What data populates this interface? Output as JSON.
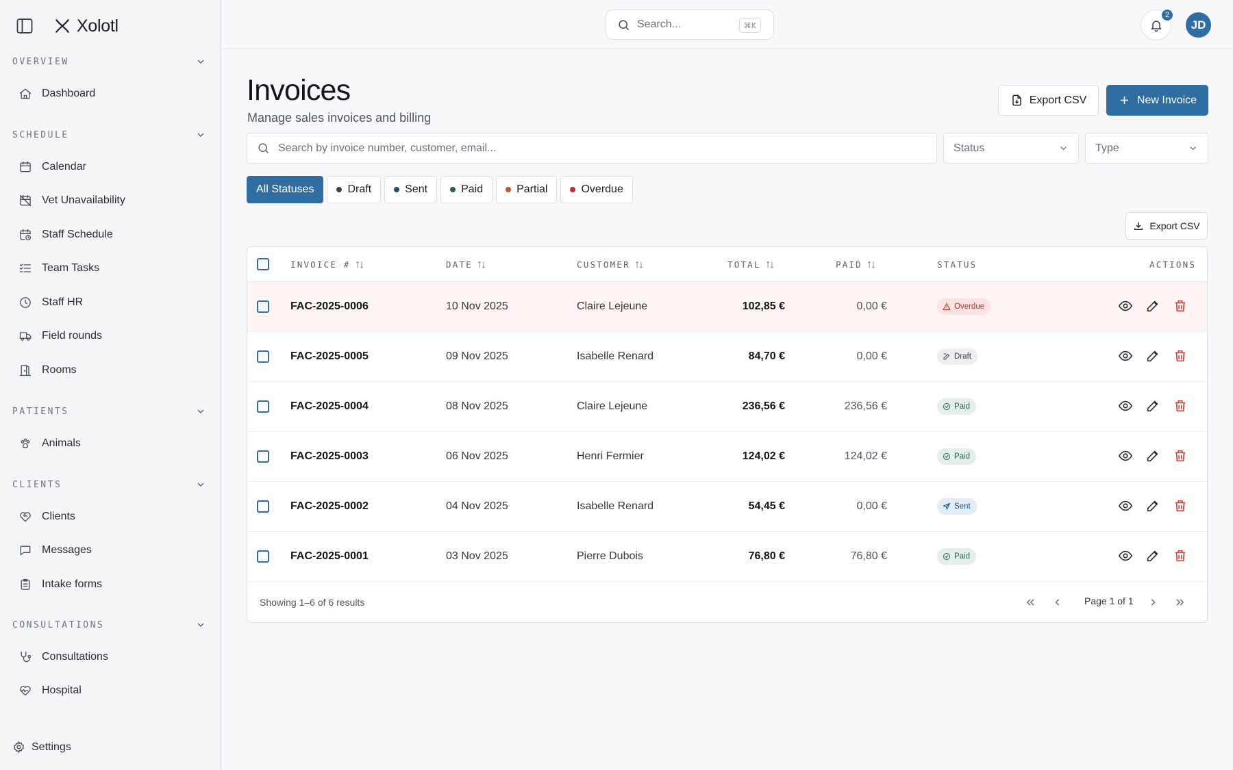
{
  "app": {
    "name": "Xolotl"
  },
  "sidebar": {
    "sections": [
      {
        "title": "OVERVIEW",
        "items": [
          {
            "label": "Dashboard",
            "icon": "home-icon"
          }
        ]
      },
      {
        "title": "SCHEDULE",
        "items": [
          {
            "label": "Calendar",
            "icon": "calendar-icon"
          },
          {
            "label": "Vet Unavailability",
            "icon": "calendar-off-icon"
          },
          {
            "label": "Staff Schedule",
            "icon": "calendar-clock-icon"
          },
          {
            "label": "Team Tasks",
            "icon": "list-checks-icon"
          },
          {
            "label": "Staff HR",
            "icon": "clock-icon"
          },
          {
            "label": "Field rounds",
            "icon": "truck-icon"
          },
          {
            "label": "Rooms",
            "icon": "door-icon"
          }
        ]
      },
      {
        "title": "PATIENTS",
        "items": [
          {
            "label": "Animals",
            "icon": "paw-icon"
          }
        ]
      },
      {
        "title": "CLIENTS",
        "items": [
          {
            "label": "Clients",
            "icon": "heart-handshake-icon"
          },
          {
            "label": "Messages",
            "icon": "message-icon"
          },
          {
            "label": "Intake forms",
            "icon": "clipboard-icon"
          }
        ]
      },
      {
        "title": "CONSULTATIONS",
        "items": [
          {
            "label": "Consultations",
            "icon": "stethoscope-icon"
          },
          {
            "label": "Hospital",
            "icon": "heart-pulse-icon"
          }
        ]
      }
    ],
    "settings_label": "Settings"
  },
  "topbar": {
    "search_placeholder": "Search...",
    "search_shortcut": "⌘K",
    "notification_count": "2",
    "avatar_initials": "JD"
  },
  "page": {
    "title": "Invoices",
    "subtitle": "Manage sales invoices and billing",
    "export_label": "Export CSV",
    "new_label": "New Invoice",
    "search_placeholder": "Search by invoice number, customer, email...",
    "status_select": "Status",
    "type_select": "Type",
    "table_export_label": "Export CSV"
  },
  "chips": [
    {
      "label": "All Statuses",
      "active": true
    },
    {
      "label": "Draft",
      "color": "#3d4248"
    },
    {
      "label": "Sent",
      "color": "#1f4e79"
    },
    {
      "label": "Paid",
      "color": "#2e5e4e"
    },
    {
      "label": "Partial",
      "color": "#b5583a"
    },
    {
      "label": "Overdue",
      "color": "#b83232"
    }
  ],
  "table": {
    "headers": {
      "invoice": "INVOICE #",
      "date": "DATE",
      "customer": "CUSTOMER",
      "total": "TOTAL",
      "paid": "PAID",
      "status": "STATUS",
      "actions": "ACTIONS"
    },
    "rows": [
      {
        "invoice": "FAC-2025-0006",
        "date": "10 Nov 2025",
        "customer": "Claire Lejeune",
        "total": "102,85 €",
        "paid": "0,00 €",
        "status": "Overdue"
      },
      {
        "invoice": "FAC-2025-0005",
        "date": "09 Nov 2025",
        "customer": "Isabelle Renard",
        "total": "84,70 €",
        "paid": "0,00 €",
        "status": "Draft"
      },
      {
        "invoice": "FAC-2025-0004",
        "date": "08 Nov 2025",
        "customer": "Claire Lejeune",
        "total": "236,56 €",
        "paid": "236,56 €",
        "status": "Paid"
      },
      {
        "invoice": "FAC-2025-0003",
        "date": "06 Nov 2025",
        "customer": "Henri Fermier",
        "total": "124,02 €",
        "paid": "124,02 €",
        "status": "Paid"
      },
      {
        "invoice": "FAC-2025-0002",
        "date": "04 Nov 2025",
        "customer": "Isabelle Renard",
        "total": "54,45 €",
        "paid": "0,00 €",
        "status": "Sent"
      },
      {
        "invoice": "FAC-2025-0001",
        "date": "03 Nov 2025",
        "customer": "Pierre Dubois",
        "total": "76,80 €",
        "paid": "76,80 €",
        "status": "Paid"
      }
    ],
    "summary": "Showing 1–6 of 6 results",
    "page_label": "Page 1 of 1"
  },
  "status_styles": {
    "Overdue": {
      "bg": "#fbe3e1",
      "fg": "#b83232",
      "icon": "alert-triangle-icon"
    },
    "Draft": {
      "bg": "#eceef0",
      "fg": "#3d4248",
      "icon": "pencil-square-icon"
    },
    "Paid": {
      "bg": "#e3efe9",
      "fg": "#2e5e4e",
      "icon": "check-circle-icon"
    },
    "Sent": {
      "bg": "#e2ecf6",
      "fg": "#1f4e79",
      "icon": "send-icon"
    }
  },
  "colors": {
    "accent": "#2f6da3",
    "danger": "#d0443f"
  }
}
